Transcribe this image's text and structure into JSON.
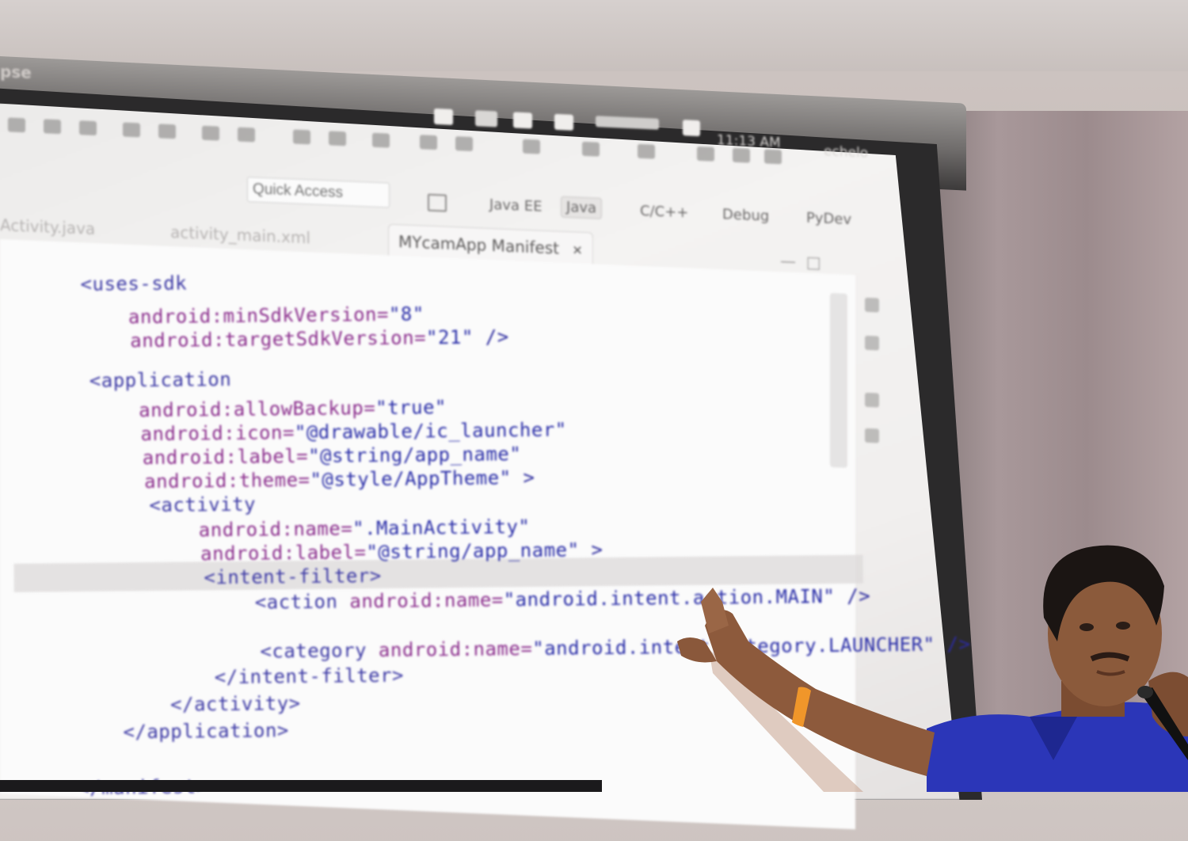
{
  "system_bar": {
    "app_title": "pse",
    "clock": "11:13 AM",
    "user": "echelo"
  },
  "quick_access": {
    "placeholder": "Quick Access"
  },
  "perspectives": [
    {
      "label": "Java EE",
      "active": false
    },
    {
      "label": "Java",
      "active": true
    },
    {
      "label": "C/C++",
      "active": false
    },
    {
      "label": "Debug",
      "active": false
    },
    {
      "label": "PyDev",
      "active": false
    }
  ],
  "editor_tabs": [
    {
      "label": "Activity.java",
      "active": false
    },
    {
      "label": "activity_main.xml",
      "active": false
    },
    {
      "label": "MYcamApp Manifest",
      "active": true
    }
  ],
  "tab_close_glyph": "✕",
  "code": {
    "l1": "<uses-sdk",
    "l2a": "android:minSdkVersion=",
    "l2b": "\"8\"",
    "l3a": "android:targetSdkVersion=",
    "l3b": "\"21\"",
    "l3c": " />",
    "l4": "<application",
    "l5a": "android:allowBackup=",
    "l5b": "\"true\"",
    "l6a": "android:icon=",
    "l6b": "\"@drawable/ic_launcher\"",
    "l7a": "android:label=",
    "l7b": "\"@string/app_name\"",
    "l8a": "android:theme=",
    "l8b": "\"@style/AppTheme\"",
    "l8c": " >",
    "l9": "<activity",
    "l10a": "android:name=",
    "l10b": "\".MainActivity\"",
    "l11a": "android:label=",
    "l11b": "\"@string/app_name\"",
    "l11c": " >",
    "l12": "<intent-filter>",
    "l13a": "<action ",
    "l13b": "android:name=",
    "l13c": "\"android.intent.action.MAIN\"",
    "l13d": " />",
    "l14a": "<category ",
    "l14b": "android:name=",
    "l14c": "\"android.intent.category.LAUNCHER\"",
    "l14d": " />",
    "l15": "</intent-filter>",
    "l16": "</activity>",
    "l17": "</application>",
    "l18": "</manifest>"
  },
  "colors": {
    "tag": "#3d3aa5",
    "attribute": "#8b2e8d",
    "value": "#2a2ea8",
    "shirt": "#2b36b8",
    "wristband": "#f0962a"
  }
}
